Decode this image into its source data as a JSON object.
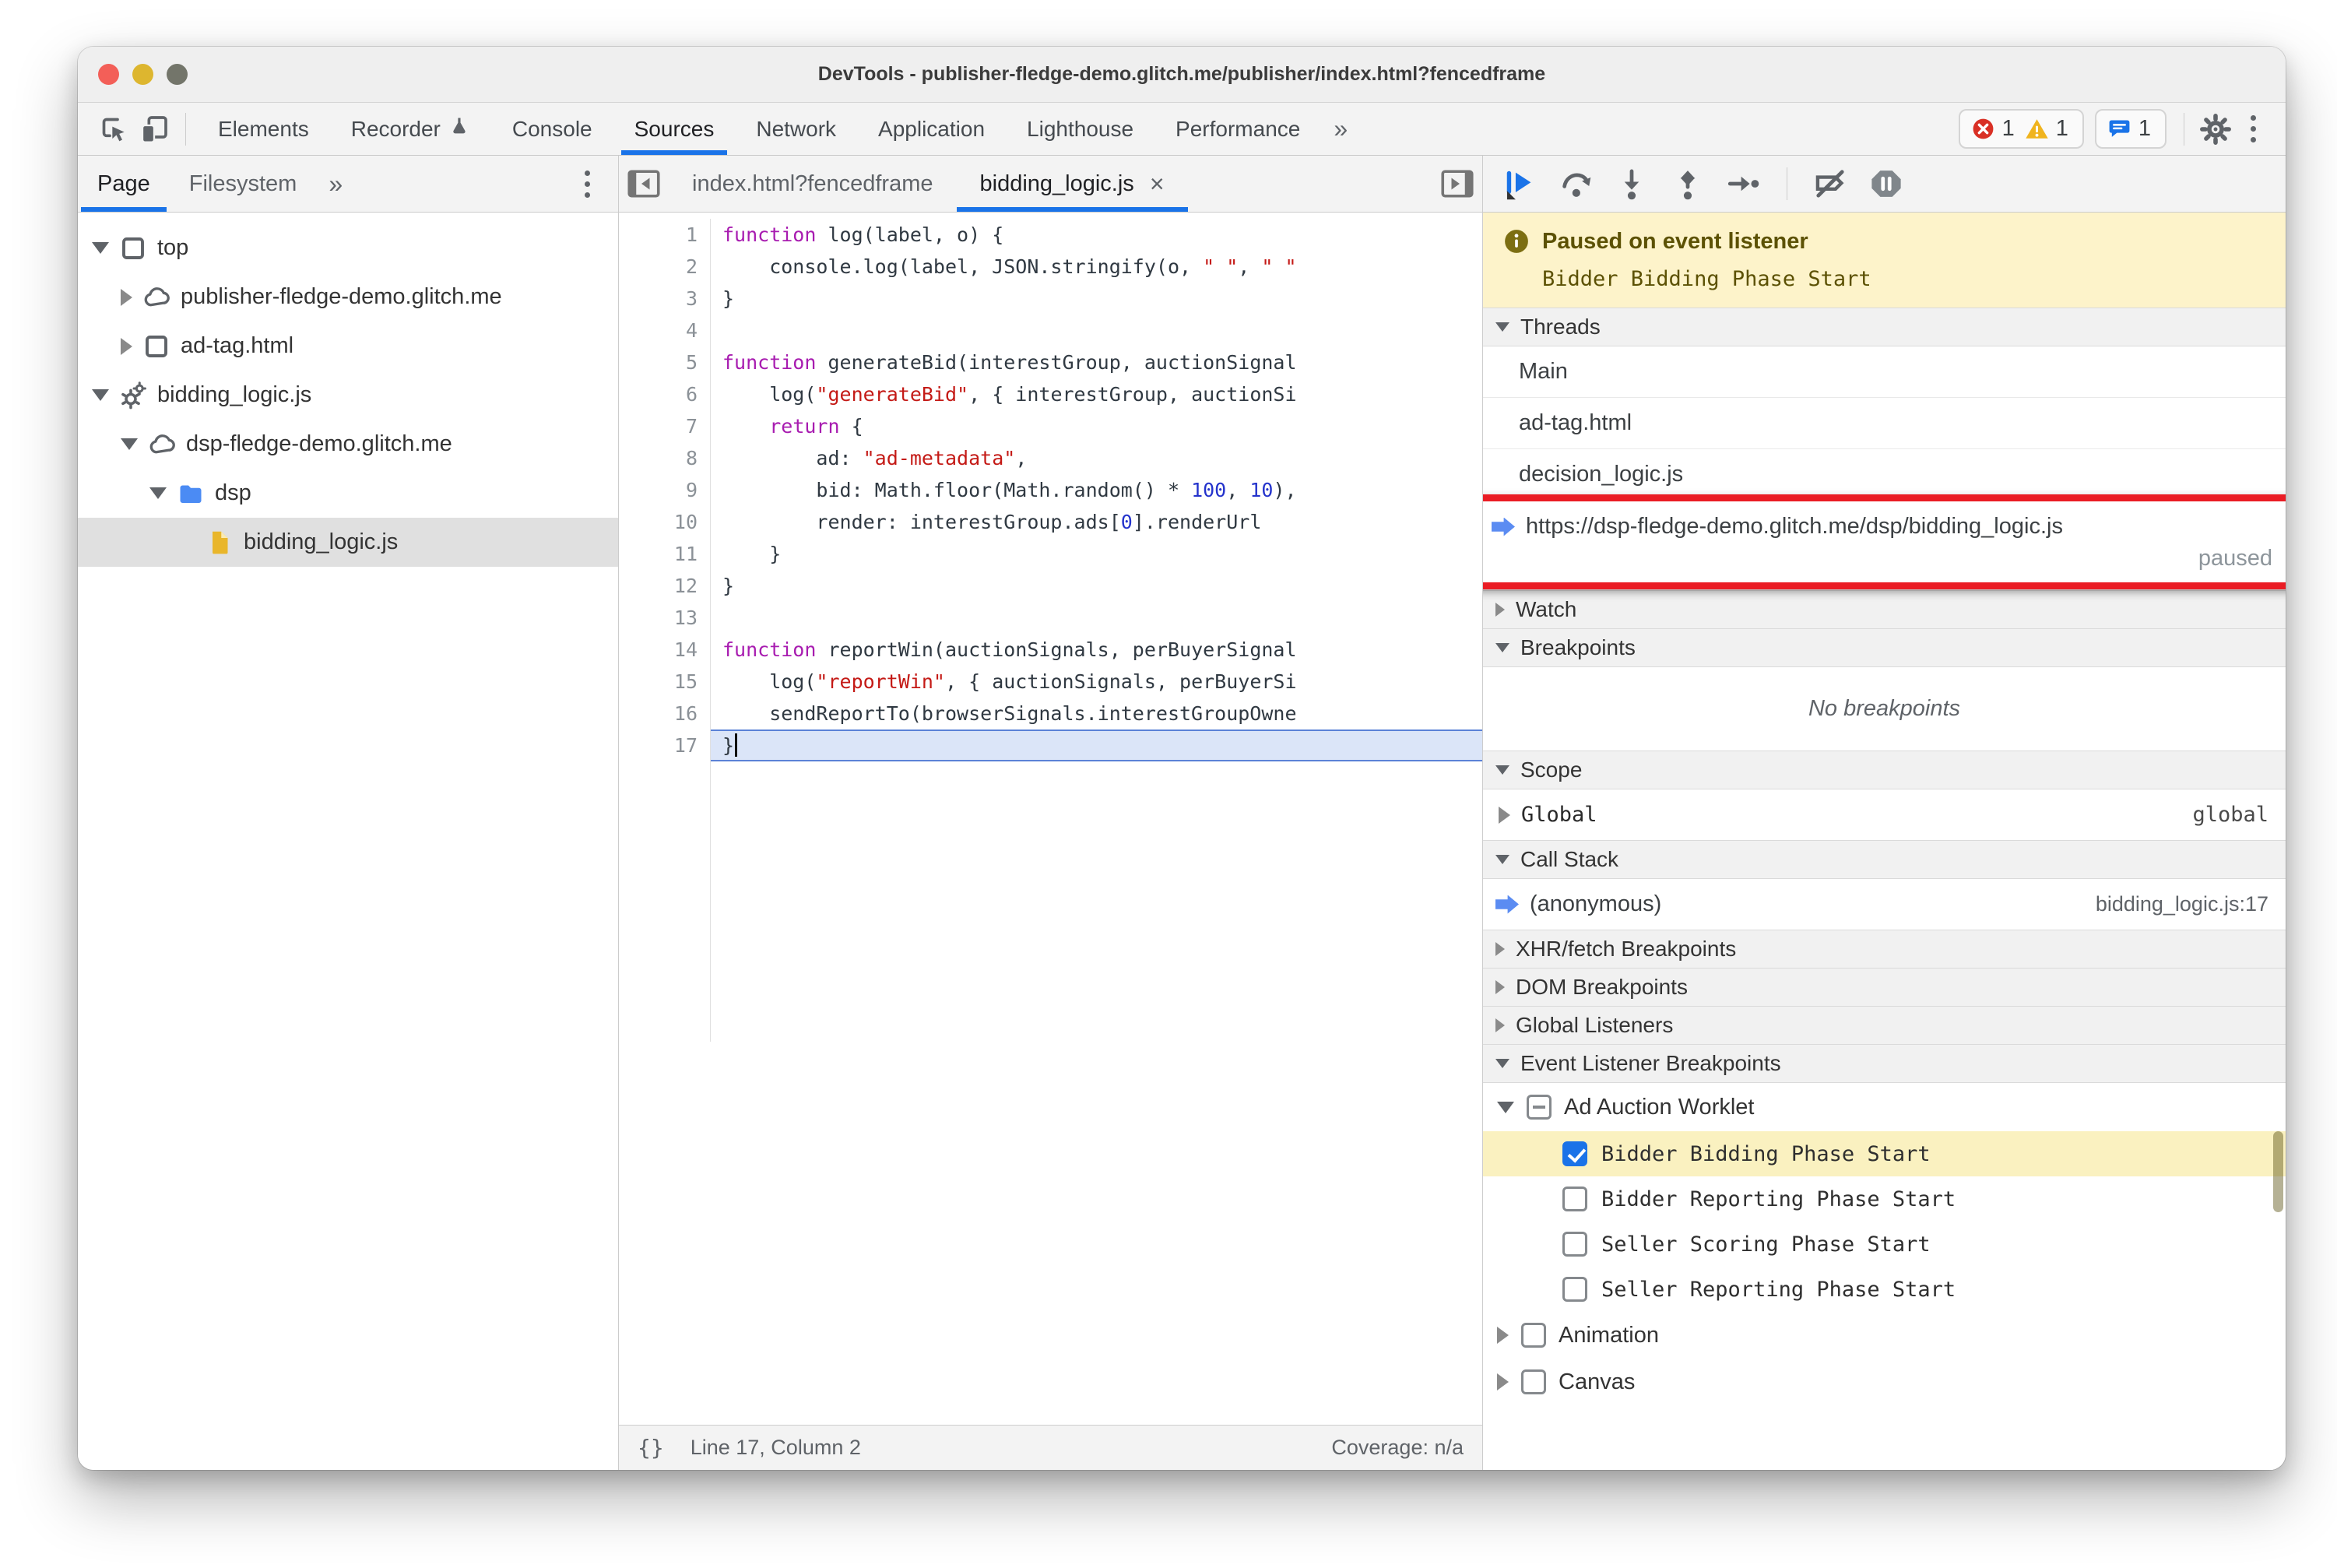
{
  "colors": {
    "accent": "#1a73e8",
    "annotation_box": "#ea1c24",
    "paused_banner_bg": "#fdf3ca",
    "traffic_lights": [
      "#f35f58",
      "#ddb62f",
      "#73756a"
    ]
  },
  "window": {
    "title": "DevTools - publisher-fledge-demo.glitch.me/publisher/index.html?fencedframe"
  },
  "toolbar": {
    "tabs": [
      {
        "label": "Elements"
      },
      {
        "label": "Recorder",
        "flask": true
      },
      {
        "label": "Console"
      },
      {
        "label": "Sources",
        "active": true
      },
      {
        "label": "Network"
      },
      {
        "label": "Application"
      },
      {
        "label": "Lighthouse"
      },
      {
        "label": "Performance"
      }
    ],
    "more_label": "»",
    "badges": {
      "errors": "1",
      "warnings": "1",
      "issues": "1"
    }
  },
  "navigator": {
    "tabs": [
      {
        "label": "Page",
        "active": true
      },
      {
        "label": "Filesystem"
      }
    ],
    "more_label": "»",
    "tree": [
      {
        "label": "top",
        "icon": "frame",
        "depth": 0,
        "disclosure": "exp"
      },
      {
        "label": "publisher-fledge-demo.glitch.me",
        "icon": "cloud",
        "depth": 1,
        "disclosure": "col"
      },
      {
        "label": "ad-tag.html",
        "icon": "frame",
        "depth": 1,
        "disclosure": "col"
      },
      {
        "label": "bidding_logic.js",
        "icon": "gears",
        "depth": 0,
        "disclosure": "exp"
      },
      {
        "label": "dsp-fledge-demo.glitch.me",
        "icon": "cloud",
        "depth": 1,
        "disclosure": "exp"
      },
      {
        "label": "dsp",
        "icon": "folder",
        "depth": 2,
        "disclosure": "exp"
      },
      {
        "label": "bidding_logic.js",
        "icon": "file",
        "depth": 3,
        "disclosure": "none",
        "selected": true
      }
    ]
  },
  "editor": {
    "tabs": [
      {
        "label": "index.html?fencedframe"
      },
      {
        "label": "bidding_logic.js",
        "active": true,
        "close_label": "×"
      }
    ],
    "lines": [
      {
        "n": 1,
        "segs": [
          {
            "c": "kw",
            "t": "function"
          },
          {
            "c": "",
            "t": " log(label, o) {"
          }
        ]
      },
      {
        "n": 2,
        "segs": [
          {
            "c": "",
            "t": "    console.log(label, JSON.stringify(o, "
          },
          {
            "c": "str",
            "t": "\" \""
          },
          {
            "c": "",
            "t": ", "
          },
          {
            "c": "str",
            "t": "\" \""
          }
        ]
      },
      {
        "n": 3,
        "segs": [
          {
            "c": "",
            "t": "}"
          }
        ]
      },
      {
        "n": 4,
        "segs": []
      },
      {
        "n": 5,
        "segs": [
          {
            "c": "kw",
            "t": "function"
          },
          {
            "c": "",
            "t": " generateBid(interestGroup, auctionSignal"
          }
        ]
      },
      {
        "n": 6,
        "segs": [
          {
            "c": "",
            "t": "    log("
          },
          {
            "c": "str",
            "t": "\"generateBid\""
          },
          {
            "c": "",
            "t": ", { interestGroup, auctionSi"
          }
        ]
      },
      {
        "n": 7,
        "segs": [
          {
            "c": "",
            "t": "    "
          },
          {
            "c": "kw",
            "t": "return"
          },
          {
            "c": "",
            "t": " {"
          }
        ]
      },
      {
        "n": 8,
        "segs": [
          {
            "c": "",
            "t": "        ad: "
          },
          {
            "c": "str",
            "t": "\"ad-metadata\""
          },
          {
            "c": "",
            "t": ","
          }
        ]
      },
      {
        "n": 9,
        "segs": [
          {
            "c": "",
            "t": "        bid: Math.floor(Math.random() * "
          },
          {
            "c": "num",
            "t": "100"
          },
          {
            "c": "",
            "t": ", "
          },
          {
            "c": "num",
            "t": "10"
          },
          {
            "c": "",
            "t": "),"
          }
        ]
      },
      {
        "n": 10,
        "segs": [
          {
            "c": "",
            "t": "        render: interestGroup.ads["
          },
          {
            "c": "num",
            "t": "0"
          },
          {
            "c": "",
            "t": "].renderUrl"
          }
        ]
      },
      {
        "n": 11,
        "segs": [
          {
            "c": "",
            "t": "    }"
          }
        ]
      },
      {
        "n": 12,
        "segs": [
          {
            "c": "",
            "t": "}"
          }
        ]
      },
      {
        "n": 13,
        "segs": []
      },
      {
        "n": 14,
        "segs": [
          {
            "c": "kw",
            "t": "function"
          },
          {
            "c": "",
            "t": " reportWin(auctionSignals, perBuyerSignal"
          }
        ]
      },
      {
        "n": 15,
        "segs": [
          {
            "c": "",
            "t": "    log("
          },
          {
            "c": "str",
            "t": "\"reportWin\""
          },
          {
            "c": "",
            "t": ", { auctionSignals, perBuyerSi"
          }
        ]
      },
      {
        "n": 16,
        "segs": [
          {
            "c": "",
            "t": "    sendReportTo(browserSignals.interestGroupOwne"
          }
        ]
      },
      {
        "n": 17,
        "segs": [
          {
            "c": "",
            "t": "}"
          }
        ],
        "exec": true
      }
    ],
    "status": {
      "braces": "{}",
      "line_col": "Line 17, Column 2",
      "coverage": "Coverage: n/a"
    }
  },
  "debugger": {
    "banner": {
      "title": "Paused on event listener",
      "detail": "Bidder Bidding Phase Start"
    },
    "threads": {
      "label": "Threads",
      "items": [
        "Main",
        "ad-tag.html",
        "decision_logic.js"
      ],
      "paused_thread": {
        "url": "https://dsp-fledge-demo.glitch.me/dsp/bidding_logic.js",
        "status": "paused"
      }
    },
    "watch": {
      "label": "Watch"
    },
    "breakpoints": {
      "label": "Breakpoints",
      "empty": "No breakpoints"
    },
    "scope": {
      "label": "Scope",
      "rows": [
        {
          "name": "Global",
          "value": "global"
        }
      ]
    },
    "call_stack": {
      "label": "Call Stack",
      "frames": [
        {
          "name": "(anonymous)",
          "location": "bidding_logic.js:17"
        }
      ]
    },
    "xhr": {
      "label": "XHR/fetch Breakpoints"
    },
    "dom": {
      "label": "DOM Breakpoints"
    },
    "global_listeners": {
      "label": "Global Listeners"
    },
    "event_listener_breakpoints": {
      "label": "Event Listener Breakpoints",
      "group": {
        "label": "Ad Auction Worklet",
        "state": "indeterminate"
      },
      "phases": [
        {
          "label": "Bidder Bidding Phase Start",
          "checked": true,
          "highlighted": true
        },
        {
          "label": "Bidder Reporting Phase Start",
          "checked": false
        },
        {
          "label": "Seller Scoring Phase Start",
          "checked": false
        },
        {
          "label": "Seller Reporting Phase Start",
          "checked": false
        }
      ],
      "categories": [
        {
          "label": "Animation",
          "checked": false
        },
        {
          "label": "Canvas",
          "checked": false
        }
      ]
    }
  }
}
